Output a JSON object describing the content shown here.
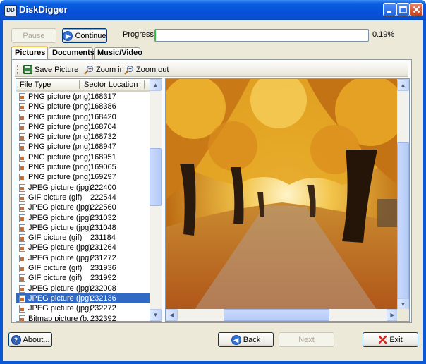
{
  "window": {
    "title": "DiskDigger",
    "icon_label": "DD"
  },
  "controls": {
    "pause_label": "Pause",
    "continue_label": "Continue",
    "progress_label": "Progress:",
    "progress_percent_text": "0.19%",
    "progress_value": 0.0019
  },
  "tabs": [
    {
      "label": "Pictures",
      "active": true
    },
    {
      "label": "Documents",
      "active": false
    },
    {
      "label": "Music/Video",
      "active": false
    }
  ],
  "toolbar": {
    "save_label": "Save Picture",
    "zoom_in_label": "Zoom in",
    "zoom_out_label": "Zoom out"
  },
  "list": {
    "columns": [
      "File Type",
      "Sector Location"
    ],
    "rows": [
      {
        "type": "PNG picture (png)",
        "sector": "168317"
      },
      {
        "type": "PNG picture (png)",
        "sector": "168386"
      },
      {
        "type": "PNG picture (png)",
        "sector": "168420"
      },
      {
        "type": "PNG picture (png)",
        "sector": "168704"
      },
      {
        "type": "PNG picture (png)",
        "sector": "168732"
      },
      {
        "type": "PNG picture (png)",
        "sector": "168947"
      },
      {
        "type": "PNG picture (png)",
        "sector": "168951"
      },
      {
        "type": "PNG picture (png)",
        "sector": "169065"
      },
      {
        "type": "PNG picture (png)",
        "sector": "169297"
      },
      {
        "type": "JPEG picture (jpg)",
        "sector": "222400"
      },
      {
        "type": "GIF picture (gif)",
        "sector": "222544"
      },
      {
        "type": "JPEG picture (jpg)",
        "sector": "222560"
      },
      {
        "type": "JPEG picture (jpg)",
        "sector": "231032"
      },
      {
        "type": "JPEG picture (jpg)",
        "sector": "231048"
      },
      {
        "type": "GIF picture (gif)",
        "sector": "231184"
      },
      {
        "type": "JPEG picture (jpg)",
        "sector": "231264"
      },
      {
        "type": "JPEG picture (jpg)",
        "sector": "231272"
      },
      {
        "type": "GIF picture (gif)",
        "sector": "231936"
      },
      {
        "type": "GIF picture (gif)",
        "sector": "231992"
      },
      {
        "type": "JPEG picture (jpg)",
        "sector": "232008"
      },
      {
        "type": "JPEG picture (jpg)",
        "sector": "232136",
        "selected": true
      },
      {
        "type": "JPEG picture (jpg)",
        "sector": "232272"
      },
      {
        "type": "Bitmap picture (b...",
        "sector": "232392"
      }
    ]
  },
  "footer": {
    "about_label": "About...",
    "back_label": "Back",
    "next_label": "Next",
    "exit_label": "Exit"
  },
  "colors": {
    "titlebar": "#0a58d6",
    "selection": "#316ac5",
    "tab_highlight": "#ffc83c",
    "progress_fill": "#2fbf43"
  }
}
